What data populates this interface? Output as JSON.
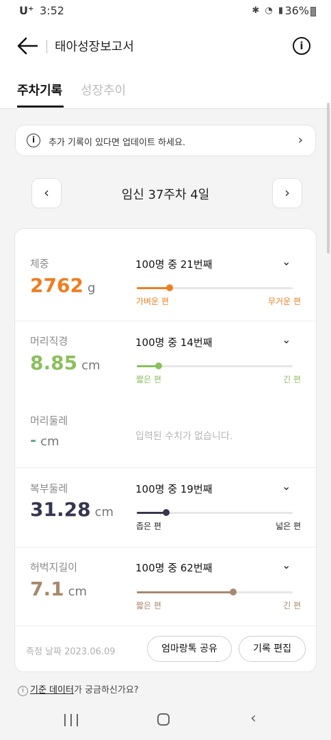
{
  "status": {
    "carrier": "U⁺",
    "time": "3:52",
    "battery": "36%"
  },
  "header": {
    "title": "태아성장보고서",
    "info_glyph": "i"
  },
  "tabs": [
    {
      "label": "주차기록"
    },
    {
      "label": "성장추이"
    }
  ],
  "notice": {
    "glyph": "i",
    "text": "추가 기록이 있다면 업데이트 하세요.",
    "chevron": "›"
  },
  "week": {
    "label": "임신 37주차 4일",
    "prev": "‹",
    "next": "›"
  },
  "metrics": {
    "weight": {
      "name": "체중",
      "value": "2762",
      "unit": "g",
      "rank": "100명 중 21번째",
      "low": "가벼운 편",
      "high": "무거운 편",
      "percentile": 21,
      "color": "#f07d1e"
    },
    "head_diam": {
      "name": "머리직경",
      "value": "8.85",
      "unit": "cm",
      "rank": "100명 중 14번째",
      "low": "짧은 편",
      "high": "긴 편",
      "percentile": 14,
      "color": "#8bbf5c"
    },
    "head_circ": {
      "name": "머리둘레",
      "value": "-",
      "unit": "cm",
      "no_data": "입력된 수치가 없습니다.",
      "color": "#6aa0a8"
    },
    "abdomen": {
      "name": "복부둘레",
      "value": "31.28",
      "unit": "cm",
      "rank": "100명 중 19번째",
      "low": "좁은 편",
      "high": "넓은 편",
      "percentile": 19,
      "color": "#363650"
    },
    "femur": {
      "name": "허벅지길이",
      "value": "7.1",
      "unit": "cm",
      "rank": "100명 중 62번째",
      "low": "짧은 편",
      "high": "긴 편",
      "percentile": 62,
      "color": "#a8886a"
    }
  },
  "footer": {
    "date": "측정 날짜 2023.06.09",
    "share": "엄마랑톡 공유",
    "edit": "기록 편집"
  },
  "help": {
    "link": "기준 데이터",
    "rest": "가 궁금하신가요?",
    "glyph": "i"
  }
}
